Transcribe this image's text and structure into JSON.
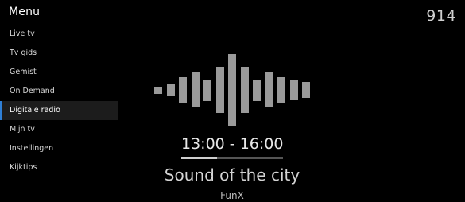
{
  "menu": {
    "title": "Menu",
    "items": [
      {
        "label": "Live tv"
      },
      {
        "label": "Tv gids"
      },
      {
        "label": "Gemist"
      },
      {
        "label": "On Demand"
      },
      {
        "label": "Digitale radio"
      },
      {
        "label": "Mijn tv"
      },
      {
        "label": "Instellingen"
      },
      {
        "label": "Kijktips"
      }
    ],
    "active_index": 4
  },
  "channel": {
    "number": "914"
  },
  "player": {
    "time_range": "13:00 - 16:00",
    "progress": 0.35,
    "show_title": "Sound of the city",
    "station": "FunX",
    "waveform_levels": [
      0.1,
      0.18,
      0.35,
      0.48,
      0.3,
      0.65,
      1.0,
      0.65,
      0.3,
      0.48,
      0.35,
      0.28,
      0.22
    ]
  },
  "colors": {
    "background": "#000000",
    "accent": "#2f7fd6",
    "waveform": "#9a9a9a"
  }
}
